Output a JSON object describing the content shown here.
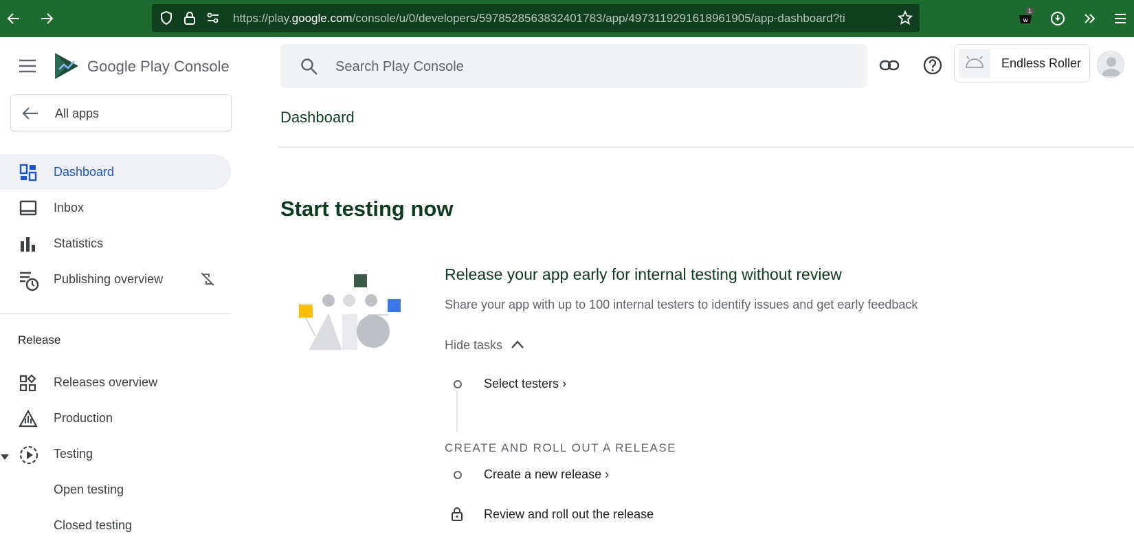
{
  "browser": {
    "url_prefix": "https://play.",
    "url_domain": "google.com",
    "url_suffix": "/console/u/0/developers/5978528563832401783/app/4973119291618961905/app-dashboard?ti",
    "extension_badge": "1"
  },
  "sidebar": {
    "logo_text": "Google Play Console",
    "all_apps_label": "All apps",
    "nav": [
      {
        "label": "Dashboard",
        "icon": "dashboard-icon",
        "active": true
      },
      {
        "label": "Inbox",
        "icon": "inbox-icon"
      },
      {
        "label": "Statistics",
        "icon": "bar-chart-icon"
      },
      {
        "label": "Publishing overview",
        "icon": "schedule-list-icon"
      }
    ],
    "release_heading": "Release",
    "release_items": [
      {
        "label": "Releases overview",
        "icon": "grid-shapes-icon"
      },
      {
        "label": "Production",
        "icon": "warning-triangle-icon"
      },
      {
        "label": "Testing",
        "icon": "play-circle-icon"
      }
    ],
    "testing_children": [
      "Open testing",
      "Closed testing"
    ]
  },
  "header": {
    "search_placeholder": "Search Play Console",
    "app_name": "Endless Roller"
  },
  "main": {
    "page_title": "Dashboard",
    "section_title": "Start testing now",
    "card": {
      "title": "Release your app early for internal testing without review",
      "description": "Share your app with up to 100 internal testers to identify issues and get early feedback",
      "toggle_label": "Hide tasks",
      "tasks": [
        {
          "label": "Select testers",
          "state": "todo"
        }
      ],
      "group_heading": "CREATE AND ROLL OUT A RELEASE",
      "group_tasks": [
        {
          "label": "Create a new release",
          "state": "todo"
        },
        {
          "label": "Review and roll out the release",
          "state": "locked"
        }
      ]
    }
  },
  "colors": {
    "browser_bar": "#1e6b30",
    "heading_green": "#0d3b1e",
    "active_blue": "#1a56c9",
    "accent_yellow": "#fbbc04",
    "accent_blue": "#3b78e7"
  }
}
